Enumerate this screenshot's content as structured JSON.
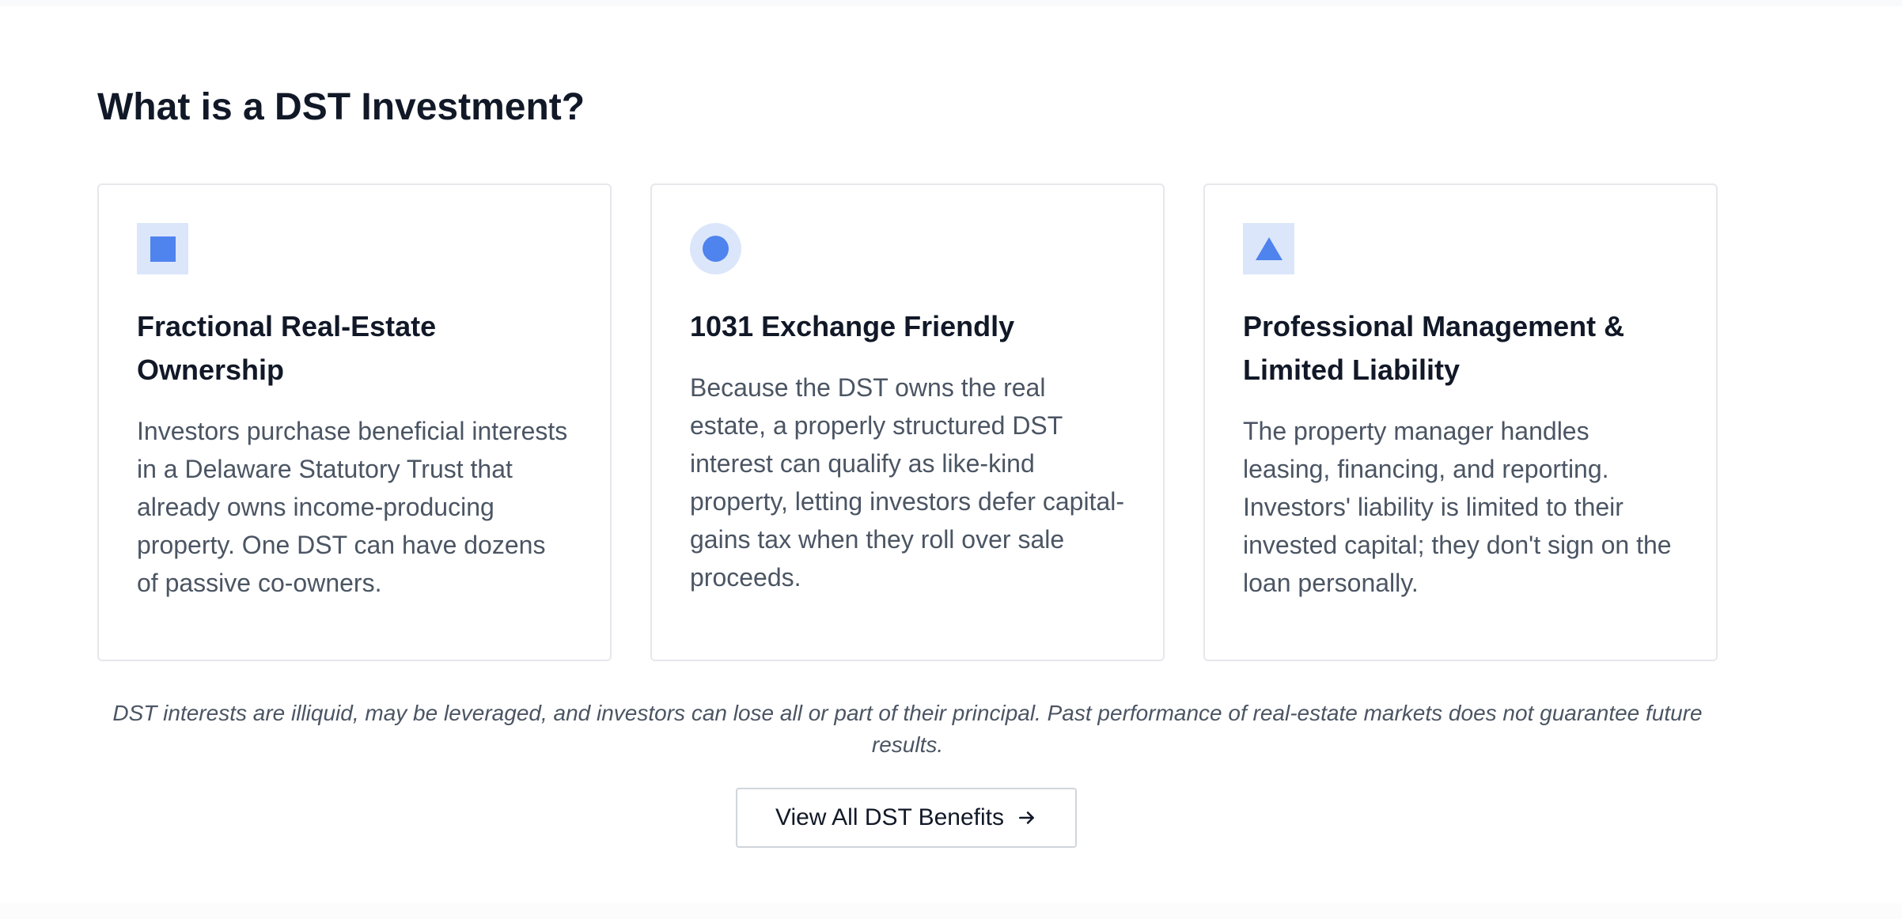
{
  "section": {
    "heading": "What is a DST Investment?"
  },
  "cards": [
    {
      "icon": "square-icon",
      "title": "Fractional Real-Estate Ownership",
      "text": "Investors purchase beneficial interests in a Delaware Statutory Trust that already owns income-producing property. One DST can have dozens of passive co-owners."
    },
    {
      "icon": "circle-icon",
      "title": "1031 Exchange Friendly",
      "text": "Because the DST owns the real estate, a properly structured DST interest can qualify as like-kind property, letting investors defer capital-gains tax when they roll over sale proceeds."
    },
    {
      "icon": "triangle-icon",
      "title": "Professional Management & Limited Liability",
      "text": "The property manager handles leasing, financing, and reporting. Investors' liability is limited to their invested capital; they don't sign on the loan personally."
    }
  ],
  "disclaimer": "DST interests are illiquid, may be leveraged, and investors can lose all or part of their principal. Past performance of real-estate markets does not guarantee future results.",
  "cta": {
    "label": "View All DST Benefits",
    "icon": "arrow-right-icon"
  },
  "colors": {
    "accent": "#4f83ed",
    "accent_bg": "#dbe6fb",
    "heading": "#111827",
    "body_text": "#4b5563",
    "border": "#e5e7eb"
  }
}
